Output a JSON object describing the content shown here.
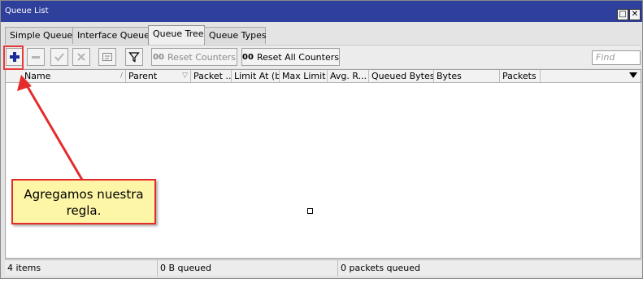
{
  "window": {
    "title": "Queue List",
    "restore_icon": "restore-icon",
    "close_icon": "close-icon",
    "restore_glyph": "□",
    "close_glyph": "✕"
  },
  "tabs": [
    {
      "label": "Simple Queues",
      "active": false
    },
    {
      "label": "Interface Queues",
      "active": false
    },
    {
      "label": "Queue Tree",
      "active": true
    },
    {
      "label": "Queue Types",
      "active": false
    }
  ],
  "toolbar": {
    "add_icon": "plus-icon",
    "remove_icon": "minus-icon",
    "enable_icon": "check-icon",
    "disable_icon": "cross-icon",
    "comment_icon": "comment-icon",
    "filter_icon": "filter-icon",
    "oo": "00",
    "reset_counters": "Reset Counters",
    "reset_all_counters": "Reset All Counters",
    "find_placeholder": "Find"
  },
  "table": {
    "columns": [
      "Name",
      "Parent",
      "Packet ...",
      "Limit At (b...",
      "Max Limit ...",
      "Avg. R...",
      "Queued Bytes",
      "Bytes",
      "Packets"
    ],
    "rows": []
  },
  "status": {
    "items": "4 items",
    "queued_bytes": "0 B queued",
    "queued_packets": "0 packets queued"
  },
  "annotation": {
    "text_line1": "Agregamos nuestra",
    "text_line2": "regla."
  },
  "colors": {
    "titlebar": "#2f3f9c",
    "annotation_red": "#e52c2c",
    "callout_fill": "#fdf6a6",
    "add_icon_blue": "#1a2b9a"
  }
}
